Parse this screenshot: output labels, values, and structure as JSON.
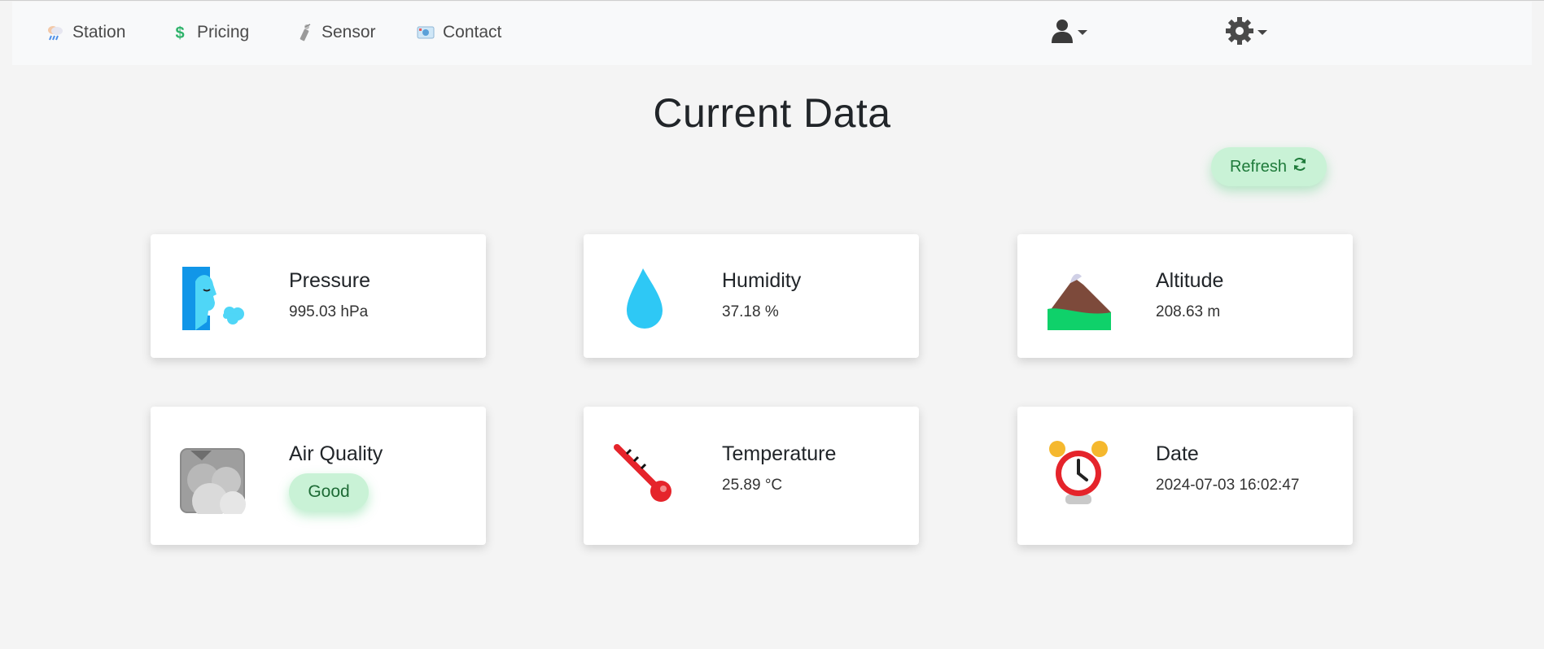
{
  "nav": {
    "items": [
      {
        "label": "Station",
        "icon": "weather-cloud-rain-icon"
      },
      {
        "label": "Pricing",
        "icon": "dollar-icon"
      },
      {
        "label": "Sensor",
        "icon": "sensor-icon"
      },
      {
        "label": "Contact",
        "icon": "contact-card-icon"
      }
    ],
    "user_icon": "user-icon",
    "settings_icon": "gear-icon"
  },
  "page": {
    "title": "Current Data",
    "refresh_label": "Refresh",
    "refresh_icon": "refresh-icon"
  },
  "cards": {
    "pressure": {
      "label": "Pressure",
      "value": "995.03 hPa",
      "icon": "face-blowing-wind-icon"
    },
    "humidity": {
      "label": "Humidity",
      "value": "37.18 %",
      "icon": "water-drop-icon"
    },
    "altitude": {
      "label": "Altitude",
      "value": "208.63 m",
      "icon": "mountain-icon"
    },
    "air_quality": {
      "label": "Air Quality",
      "value": "Good",
      "icon": "fog-clouds-icon"
    },
    "temperature": {
      "label": "Temperature",
      "value": "25.89 °C",
      "icon": "thermometer-icon"
    },
    "date": {
      "label": "Date",
      "value": "2024-07-03 16:02:47",
      "icon": "alarm-clock-icon"
    }
  },
  "colors": {
    "accent_green_bg": "#c9f2d6",
    "accent_green_text": "#1e7a3a",
    "drop_blue": "#2ec8f5",
    "thermo_red": "#e5242b"
  }
}
